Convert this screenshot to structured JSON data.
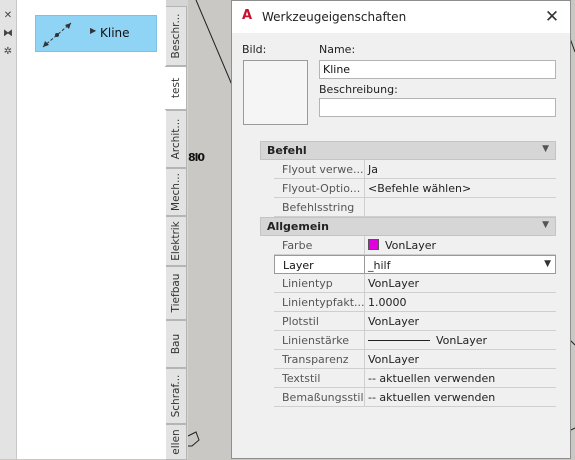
{
  "palette": {
    "tool": {
      "label": "Kline",
      "icon": "xline-tool-icon"
    },
    "tabs": [
      {
        "label": "Beschr..."
      },
      {
        "label": "test",
        "active": true
      },
      {
        "label": "Archit..."
      },
      {
        "label": "Mech..."
      },
      {
        "label": "Elektrik"
      },
      {
        "label": "Tiefbau"
      },
      {
        "label": "Bau"
      },
      {
        "label": "Schraf..."
      },
      {
        "label": "ellen"
      }
    ]
  },
  "drawing": {
    "coord_label": "8l0"
  },
  "dialog": {
    "title": "Werkzeugeigenschaften",
    "image_label": "Bild:",
    "name_label": "Name:",
    "name_value": "Kline",
    "description_label": "Beschreibung:",
    "description_value": "",
    "sections": [
      {
        "title": "Befehl",
        "rows": [
          {
            "name": "Flyout verwe...",
            "value": "Ja"
          },
          {
            "name": "Flyout-Optio...",
            "value": "<Befehle wählen>"
          },
          {
            "name": "Befehlsstring",
            "value": ""
          }
        ]
      },
      {
        "title": "Allgemein",
        "rows": [
          {
            "name": "Farbe",
            "value": "VonLayer",
            "swatch": "#e000e0"
          },
          {
            "name": "Layer",
            "value": "_hilf",
            "selected": true,
            "dropdown": true
          },
          {
            "name": "Linientyp",
            "value": "VonLayer"
          },
          {
            "name": "Linientypfakt...",
            "value": "1.0000"
          },
          {
            "name": "Plotstil",
            "value": "VonLayer"
          },
          {
            "name": "Linienstärke",
            "value": "VonLayer",
            "lineweight": true
          },
          {
            "name": "Transparenz",
            "value": "VonLayer"
          },
          {
            "name": "Textstil",
            "value": "-- aktuellen verwenden"
          },
          {
            "name": "Bemaßungsstil",
            "value": "-- aktuellen verwenden"
          }
        ]
      }
    ]
  }
}
